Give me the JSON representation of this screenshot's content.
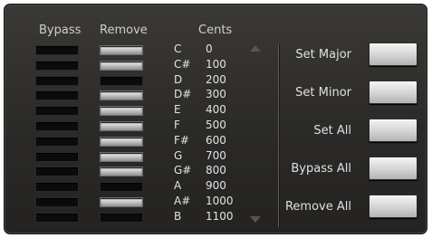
{
  "headers": {
    "bypass": "Bypass",
    "remove": "Remove",
    "cents": "Cents"
  },
  "rows": [
    {
      "note": "C",
      "cents": "0",
      "bypass": false,
      "remove": true
    },
    {
      "note": "C#",
      "cents": "100",
      "bypass": false,
      "remove": true
    },
    {
      "note": "D",
      "cents": "200",
      "bypass": false,
      "remove": false
    },
    {
      "note": "D#",
      "cents": "300",
      "bypass": false,
      "remove": true
    },
    {
      "note": "E",
      "cents": "400",
      "bypass": false,
      "remove": true
    },
    {
      "note": "F",
      "cents": "500",
      "bypass": false,
      "remove": true
    },
    {
      "note": "F#",
      "cents": "600",
      "bypass": false,
      "remove": true
    },
    {
      "note": "G",
      "cents": "700",
      "bypass": false,
      "remove": true
    },
    {
      "note": "G#",
      "cents": "800",
      "bypass": false,
      "remove": true
    },
    {
      "note": "A",
      "cents": "900",
      "bypass": false,
      "remove": false
    },
    {
      "note": "A#",
      "cents": "1000",
      "bypass": false,
      "remove": true
    },
    {
      "note": "B",
      "cents": "1100",
      "bypass": false,
      "remove": false
    }
  ],
  "actions": [
    {
      "label": "Set Major"
    },
    {
      "label": "Set Minor"
    },
    {
      "label": "Set All"
    },
    {
      "label": "Bypass All"
    },
    {
      "label": "Remove All"
    }
  ],
  "scroll": {
    "up_icon": "triangle-up",
    "down_icon": "triangle-down"
  }
}
